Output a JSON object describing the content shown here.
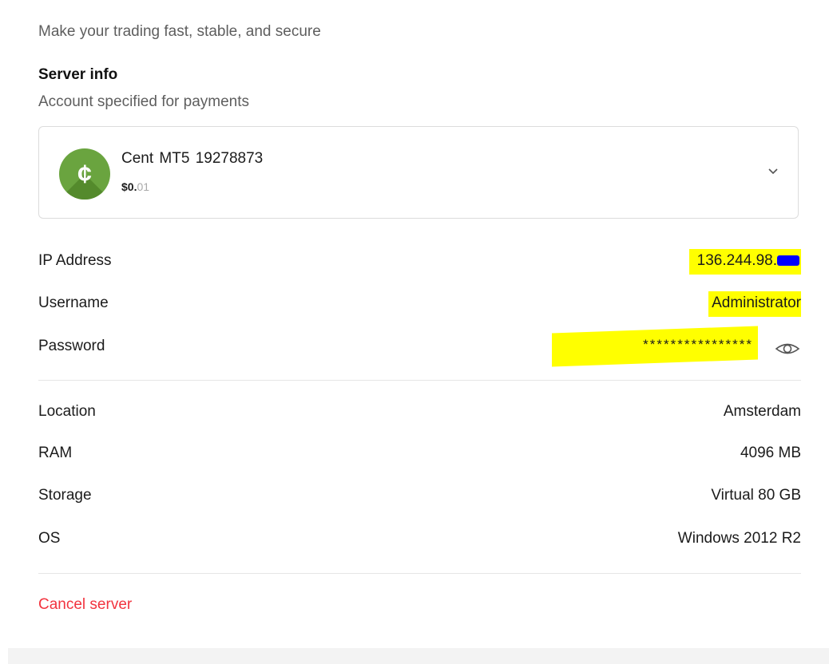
{
  "header": {
    "subtitle": "Make your trading fast, stable, and secure"
  },
  "server_info": {
    "title": "Server info",
    "description": "Account specified for payments"
  },
  "account": {
    "name": "Cent  MT5  19278873",
    "balance_main": "$0.",
    "balance_cents": "01",
    "icon": "cent-coin-icon",
    "icon_glyph": "¢",
    "icon_color": "#6aa43f"
  },
  "credentials": {
    "ip_label": "IP Address",
    "ip_value": "136.244.98.",
    "username_label": "Username",
    "username_value": "Administrator",
    "password_label": "Password",
    "password_value": "****************"
  },
  "specs": {
    "location_label": "Location",
    "location_value": "Amsterdam",
    "ram_label": "RAM",
    "ram_value": "4096 MB",
    "storage_label": "Storage",
    "storage_value": "Virtual 80 GB",
    "os_label": "OS",
    "os_value": "Windows 2012 R2"
  },
  "actions": {
    "cancel_label": "Cancel server"
  },
  "colors": {
    "highlight": "#ffff00",
    "redaction": "#0000ff",
    "danger": "#f2343f"
  }
}
